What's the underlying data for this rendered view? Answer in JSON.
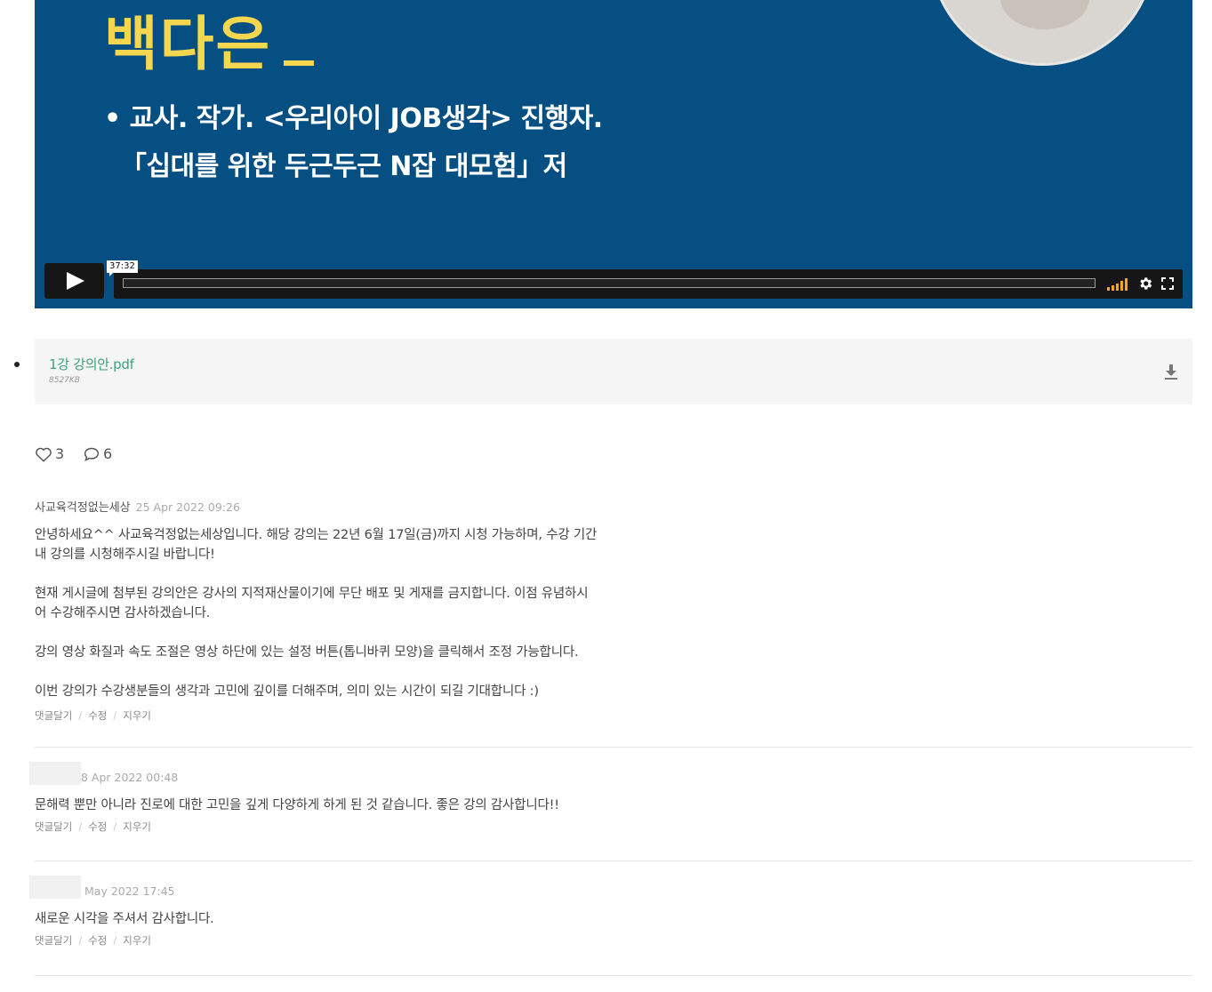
{
  "video": {
    "slide_name": "백다은",
    "slide_line1": "• 교사. 작가. <우리아이 JOB생각> 진행자.",
    "slide_line2": "「십대를 위한 두근두근 N잡 대모험」저",
    "time_tooltip": "37:32",
    "progress": 0,
    "icons": [
      "play-icon",
      "volume-icon",
      "gear-icon",
      "fullscreen-icon"
    ],
    "colors": {
      "background": "#064f83",
      "name": "#f5d64f",
      "volume": "#f5a623"
    }
  },
  "attachment": {
    "file_name": "1강 강의안.pdf",
    "file_size": "8527KB",
    "icon": "download-icon"
  },
  "reactions": {
    "likes": "3",
    "comments": "6"
  },
  "comments": [
    {
      "author": "사교육걱정없는세상",
      "date": "25 Apr 2022 09:26",
      "text": "안녕하세요^^ 사교육걱정없는세상입니다. 해당 강의는 22년 6월 17일(금)까지 시청 가능하며, 수강 기간\n내 강의를 시청해주시길 바랍니다!\n\n현재 게시글에 첨부된 강의안은 강사의 지적재산물이기에 무단 배포 및 게재를 금지합니다. 이점 유념하시\n어 수강해주시면 감사하겠습니다.\n\n강의 영상 화질과 속도 조절은 영상 하단에 있는 설정 버튼(톱니바퀴 모양)을 클릭해서 조정 가능합니다.\n\n이번 강의가 수강생분들의 생각과 고민에 깊이를 더해주며, 의미 있는 시간이 되길 기대합니다 :)",
      "actions": [
        "댓글달기",
        "수정",
        "지우기"
      ]
    },
    {
      "author": "",
      "date": "8 Apr 2022 00:48",
      "text": "문해력 뿐만 아니라 진로에 대한 고민을 깊게 다양하게 하게 된 것 같습니다. 좋은 강의 감사합니다!!",
      "actions": [
        "댓글달기",
        "수정",
        "지우기"
      ]
    },
    {
      "author": "",
      "date": "May 2022 17:45",
      "text": "새로운 시각을 주셔서 감사합니다.",
      "actions": [
        "댓글달기",
        "수정",
        "지우기"
      ]
    }
  ]
}
